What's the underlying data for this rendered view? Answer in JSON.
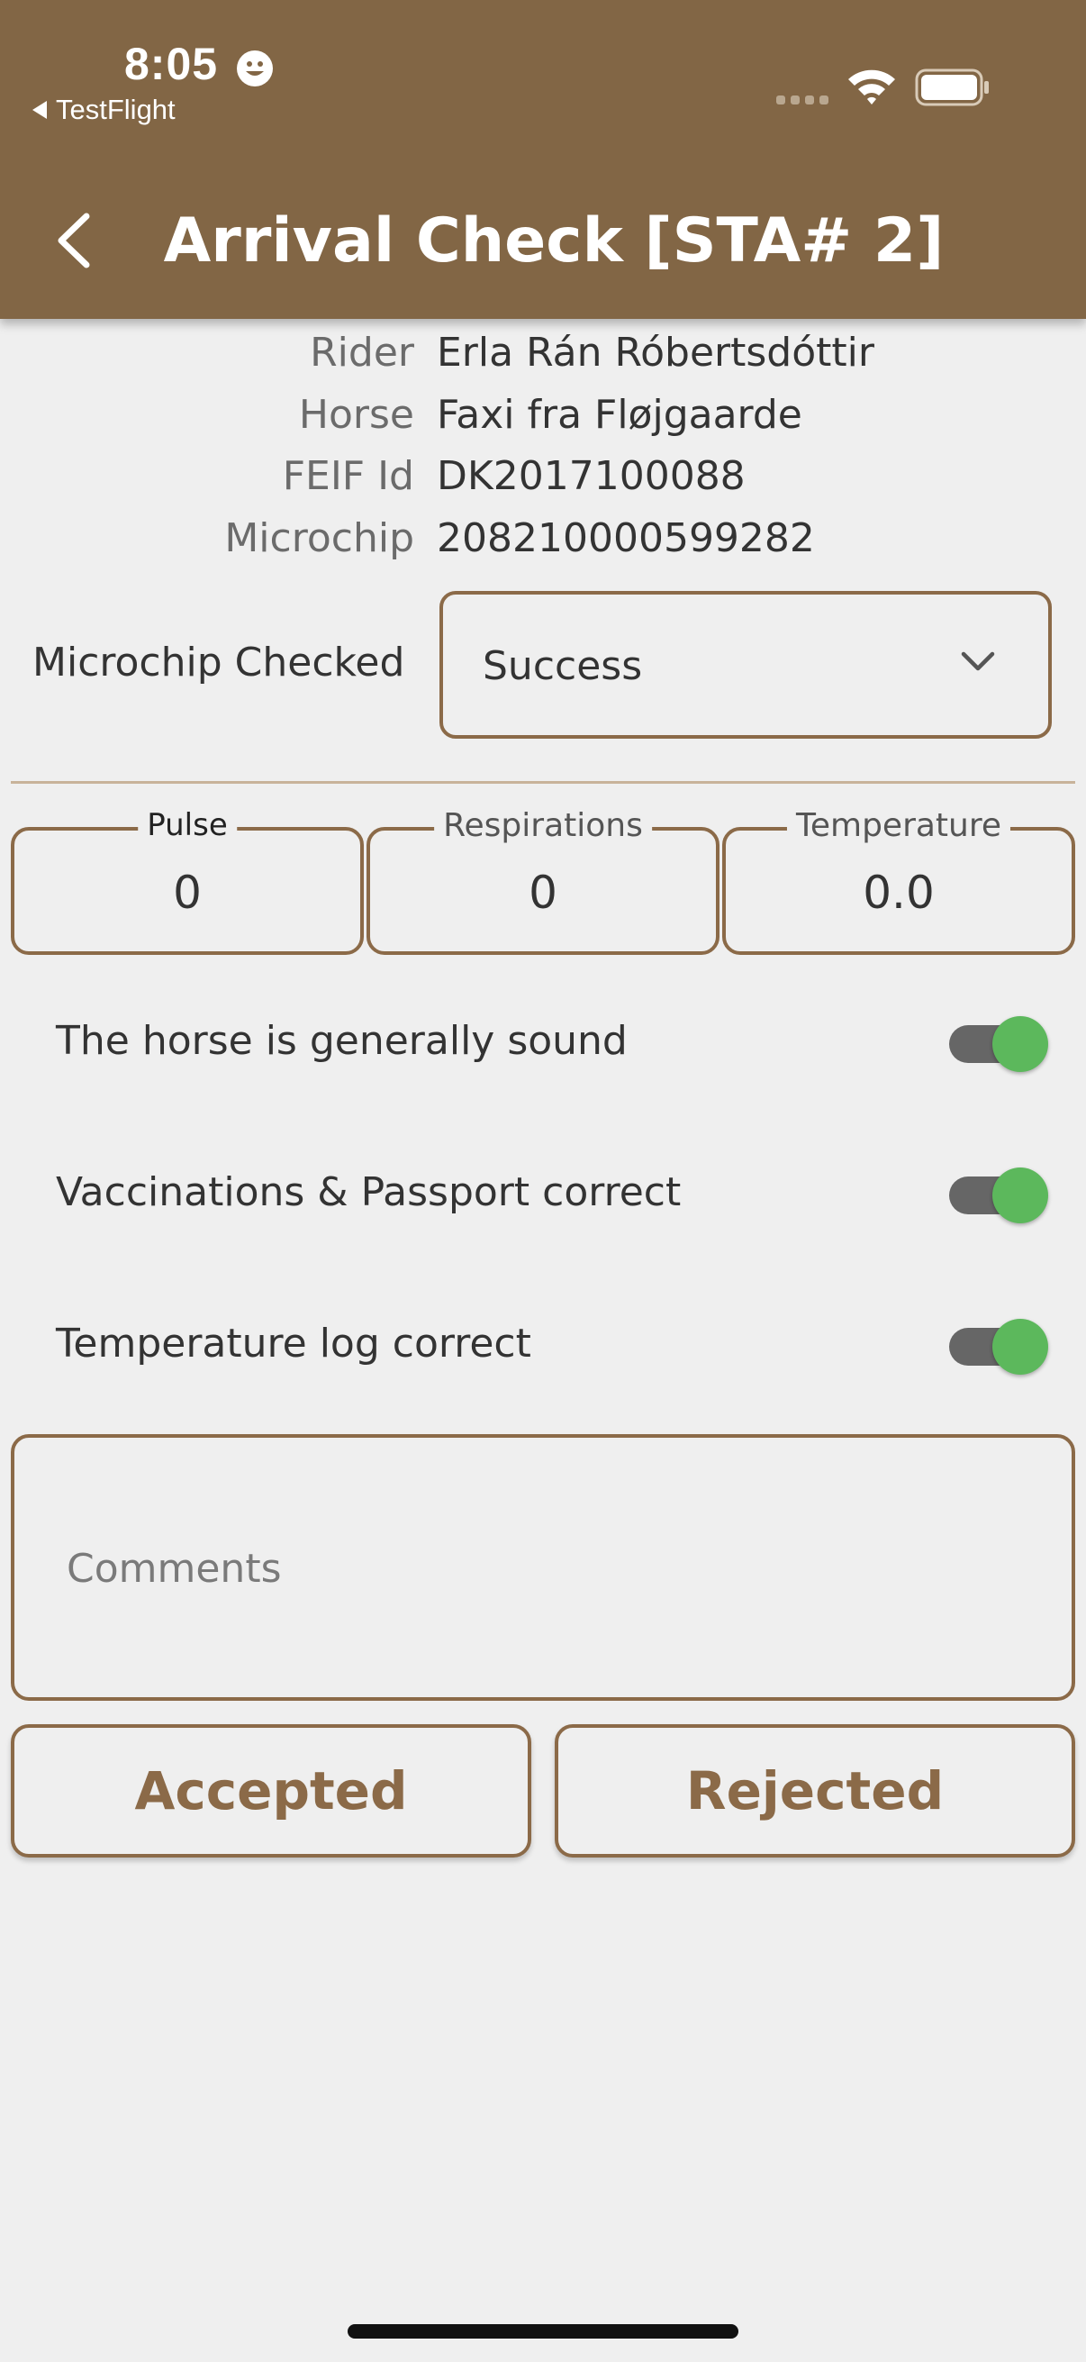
{
  "status_bar": {
    "time": "8:05",
    "back_app": "TestFlight"
  },
  "nav": {
    "title": "Arrival Check [STA# 2]"
  },
  "info": [
    {
      "label": "Rider",
      "value": "Erla Rán Róbertsdóttir"
    },
    {
      "label": "Horse",
      "value": "Faxi fra Fløjgaarde"
    },
    {
      "label": "FEIF Id",
      "value": "DK2017100088"
    },
    {
      "label": "Microchip",
      "value": "208210000599282"
    }
  ],
  "microchip_checked": {
    "label": "Microchip Checked",
    "value": "Success"
  },
  "vitals": [
    {
      "label": "Pulse",
      "value": "0"
    },
    {
      "label": "Respirations",
      "value": "0"
    },
    {
      "label": "Temperature",
      "value": "0.0"
    }
  ],
  "toggles": [
    {
      "label": "The horse is generally sound",
      "on": true
    },
    {
      "label": "Vaccinations & Passport correct",
      "on": true
    },
    {
      "label": "Temperature log correct",
      "on": true
    }
  ],
  "comments": {
    "placeholder": "Comments"
  },
  "actions": {
    "accept_label": "Accepted",
    "reject_label": "Rejected"
  },
  "colors": {
    "brand": "#826645",
    "outline": "#8b6a48",
    "toggle_on": "#5cb85c",
    "background": "#efefef"
  }
}
